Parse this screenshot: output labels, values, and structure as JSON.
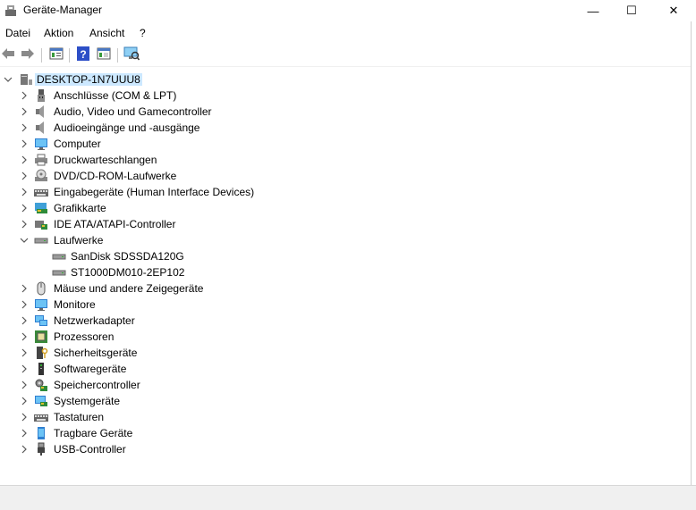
{
  "window": {
    "title": "Geräte-Manager",
    "controls": {
      "minimize": "—",
      "maximize": "☐",
      "close": "✕"
    }
  },
  "menu": [
    "Datei",
    "Aktion",
    "Ansicht",
    "?"
  ],
  "toolbar": [
    "back-icon",
    "forward-icon",
    "properties-icon",
    "help-icon",
    "view-icon",
    "scan-hardware-icon"
  ],
  "tree": {
    "root": "DESKTOP-1N7UUU8",
    "categories": [
      {
        "label": "Anschlüsse (COM & LPT)",
        "icon": "port-icon",
        "expanded": false
      },
      {
        "label": "Audio, Video und Gamecontroller",
        "icon": "speaker-icon",
        "expanded": false
      },
      {
        "label": "Audioeingänge und -ausgänge",
        "icon": "speaker-icon",
        "expanded": false
      },
      {
        "label": "Computer",
        "icon": "monitor-icon",
        "expanded": false
      },
      {
        "label": "Druckwarteschlangen",
        "icon": "printer-icon",
        "expanded": false
      },
      {
        "label": "DVD/CD-ROM-Laufwerke",
        "icon": "disc-icon",
        "expanded": false
      },
      {
        "label": "Eingabegeräte (Human Interface Devices)",
        "icon": "keyboard-icon",
        "expanded": false
      },
      {
        "label": "Grafikkarte",
        "icon": "display-adapter-icon",
        "expanded": false
      },
      {
        "label": "IDE ATA/ATAPI-Controller",
        "icon": "controller-icon",
        "expanded": false
      },
      {
        "label": "Laufwerke",
        "icon": "drive-icon",
        "expanded": true,
        "children": [
          "SanDisk SDSSDA120G",
          "ST1000DM010-2EP102"
        ]
      },
      {
        "label": "Mäuse und andere Zeigegeräte",
        "icon": "mouse-icon",
        "expanded": false
      },
      {
        "label": "Monitore",
        "icon": "monitor-icon",
        "expanded": false
      },
      {
        "label": "Netzwerkadapter",
        "icon": "network-icon",
        "expanded": false
      },
      {
        "label": "Prozessoren",
        "icon": "cpu-icon",
        "expanded": false
      },
      {
        "label": "Sicherheitsgeräte",
        "icon": "security-icon",
        "expanded": false
      },
      {
        "label": "Softwaregeräte",
        "icon": "software-device-icon",
        "expanded": false
      },
      {
        "label": "Speichercontroller",
        "icon": "storage-controller-icon",
        "expanded": false
      },
      {
        "label": "Systemgeräte",
        "icon": "system-device-icon",
        "expanded": false
      },
      {
        "label": "Tastaturen",
        "icon": "keyboard-icon",
        "expanded": false
      },
      {
        "label": "Tragbare Geräte",
        "icon": "portable-device-icon",
        "expanded": false
      },
      {
        "label": "USB-Controller",
        "icon": "usb-icon",
        "expanded": false
      }
    ]
  },
  "colors": {
    "selection": "#cce8ff",
    "statusbar": "#f0f0f0"
  }
}
